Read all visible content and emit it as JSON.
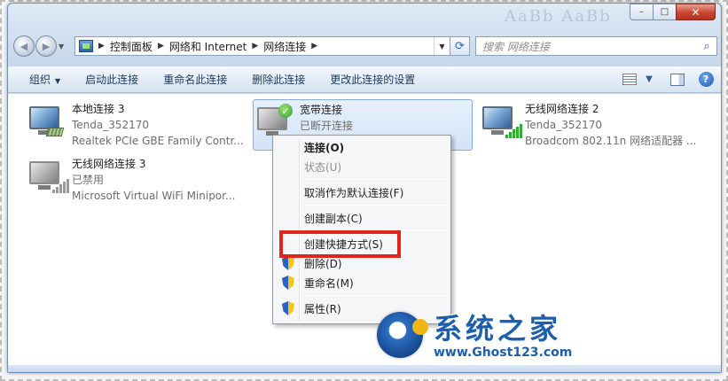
{
  "window": {
    "min_glyph": "–",
    "max_glyph": "□",
    "close_glyph": "✕"
  },
  "address_bar": {
    "crumbs": [
      "控制面板",
      "网络和 Internet",
      "网络连接"
    ],
    "search_placeholder": "搜索 网络连接"
  },
  "toolbar": {
    "organize": "组织",
    "enable": "启动此连接",
    "rename": "重命名此连接",
    "delete": "删除此连接",
    "change_settings": "更改此连接的设置"
  },
  "connections": [
    {
      "name": "本地连接 3",
      "line2": "Tenda_352170",
      "line3": "Realtek PCIe GBE Family Contr...",
      "icon": "wired-network-icon"
    },
    {
      "name": "宽带连接",
      "line2": "已断开连接",
      "line3": "",
      "icon": "broadband-icon"
    },
    {
      "name": "无线网络连接 2",
      "line2": "Tenda_352170",
      "line3": "Broadcom 802.11n 网络适配器 ...",
      "icon": "wireless-network-icon"
    },
    {
      "name": "无线网络连接 3",
      "line2": "已禁用",
      "line3": "Microsoft Virtual WiFi Minipor...",
      "icon": "wireless-disabled-icon"
    }
  ],
  "context_menu": {
    "connect": "连接(O)",
    "status": "状态(U)",
    "cancel_default": "取消作为默认连接(F)",
    "create_copy": "创建副本(C)",
    "create_shortcut": "创建快捷方式(S)",
    "delete": "删除(D)",
    "rename": "重命名(M)",
    "properties": "属性(R)"
  },
  "watermark": {
    "site_name": "系统之家",
    "site_url": "www.Ghost123.com"
  },
  "colors": {
    "highlight_box": "#e0251c",
    "logo_blue": "#1d5fae"
  }
}
